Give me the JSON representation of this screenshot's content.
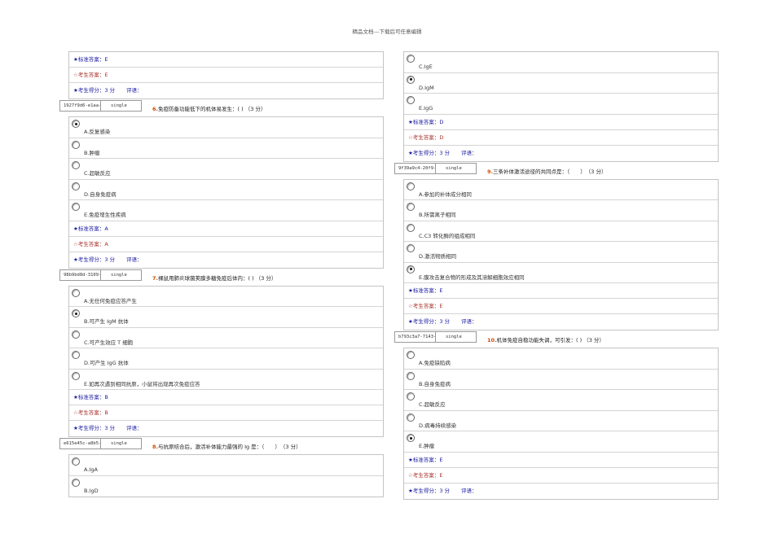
{
  "header": "精品文档---下载后可任意编辑",
  "left_column": {
    "top_result": {
      "standard": "★标准答案：E",
      "student": "☆考生答案：E",
      "score": "★考生得分：3 分",
      "comment": "评语："
    },
    "q6": {
      "id": "1927f9d6-e1aa-",
      "type": "single",
      "num": "6.",
      "text": "免疫防备功能低下的机体易发生：( ) （3 分）",
      "options": [
        "A.反复感染",
        "B.肿瘤",
        "C.超敏反应",
        "D.自身免疫病",
        "E.免疫增生性疾病"
      ],
      "selected": 0,
      "standard": "★标准答案：A",
      "student": "☆考生答案：A",
      "score": "★考生得分：3 分",
      "comment": "评语："
    },
    "q7": {
      "id": "98b9bd8d-3109-",
      "type": "single",
      "num": "7.",
      "text": "裸鼠用肺炎球菌荚膜多糖免疫后体内：( ) （3 分）",
      "options": [
        "A.无任何免疫应答产生",
        "B.可产生 IgM 抗体",
        "C.可产生效应 T 细胞",
        "D.可产生 IgG 抗体",
        "E.如再次遇到相同抗原，小鼠将出现再次免疫应答"
      ],
      "selected": 1,
      "standard": "★标准答案：B",
      "student": "☆考生答案：B",
      "score": "★考生得分：3 分",
      "comment": "评语："
    },
    "q8": {
      "id": "e615e45c-a8b5-",
      "type": "single",
      "num": "8.",
      "text": "与抗原结合后，激活补体能力最强的 Ig 是：（　　）　（3 分）",
      "options": [
        "A.IgA",
        "B.IgD"
      ]
    }
  },
  "right_column": {
    "q8_cont": {
      "options": [
        "C.IgE",
        "D.IgM",
        "E.IgG"
      ],
      "selected": 1,
      "standard": "★标准答案：D",
      "student": "☆考生答案：D",
      "score": "★考生得分：3 分",
      "comment": "评语："
    },
    "q9": {
      "id": "9f39a9c4-20f9-",
      "type": "single",
      "num": "9.",
      "text": "三条补体激活途径的共同点是：（　　）　（3 分）",
      "options": [
        "A.参加的补体成分相同",
        "B.所需离子相同",
        "C.C3 转化酶的组成相同",
        "D.激活物质相同",
        "E.膜攻击复合物的形成及其溶解细胞效应相同"
      ],
      "selected": 4,
      "standard": "★标准答案：E",
      "student": "☆考生答案：E",
      "score": "★考生得分：3 分",
      "comment": "评语："
    },
    "q10": {
      "id": "b793c3a7-7143-",
      "type": "single",
      "num": "10.",
      "text": "机体免疫自稳功能失调，可引发：( ) （3 分）",
      "options": [
        "A.免疫缺陷病",
        "B.自身免疫病",
        "C.超敏反应",
        "D.病毒持续感染",
        "E.肿瘤"
      ],
      "selected": 4,
      "standard": "★标准答案：E",
      "student": "☆考生答案：E",
      "score": "★考生得分：3 分",
      "comment": "评语："
    }
  }
}
